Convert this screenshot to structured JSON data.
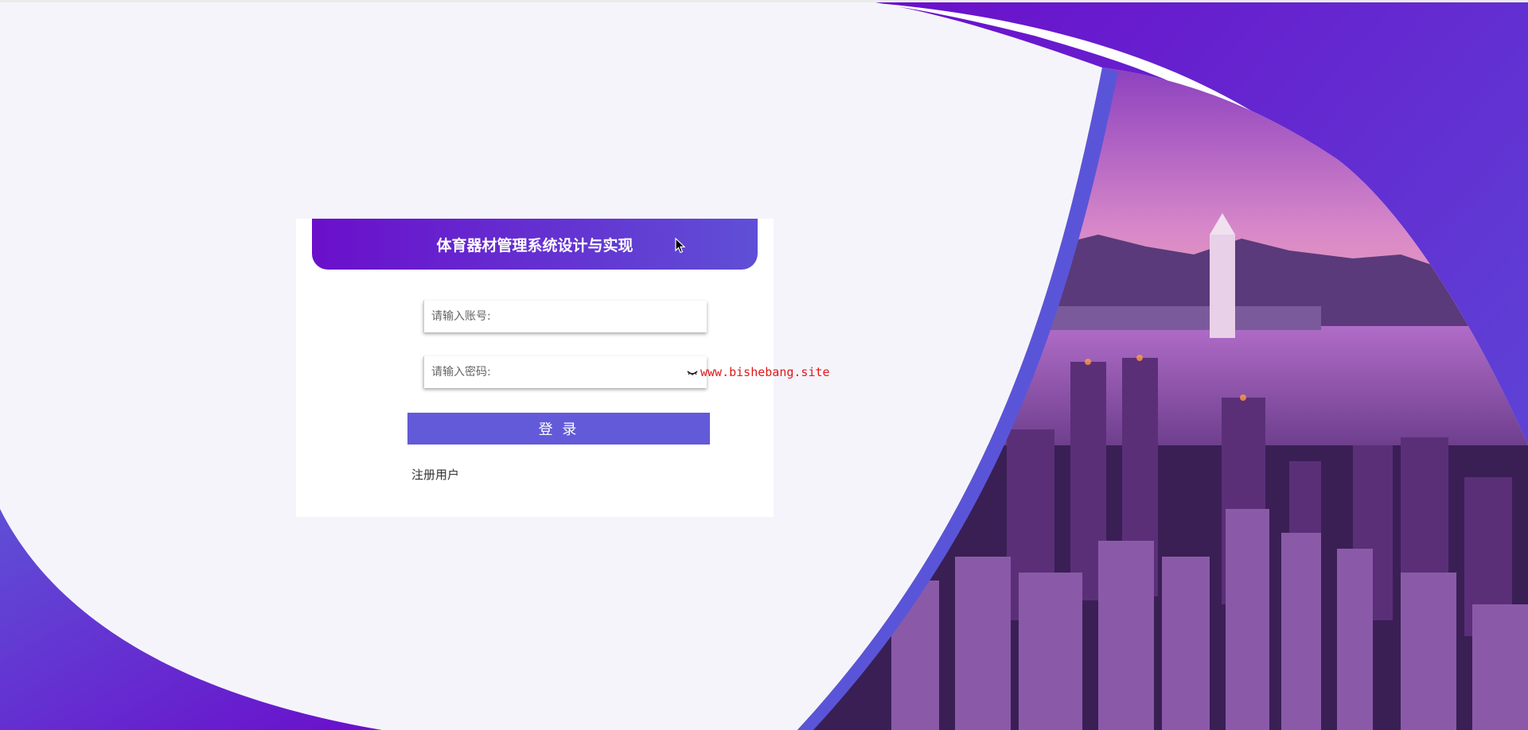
{
  "header": {
    "title": "体育器材管理系统设计与实现"
  },
  "form": {
    "account_label": "账号:",
    "account_placeholder": "请输入账号:",
    "account_value": "",
    "password_label": "密码:",
    "password_placeholder": "请输入密码:",
    "password_value": "",
    "login_label": "登 录",
    "register_label": "注册用户"
  },
  "watermark": {
    "text": "www.bishebang.site"
  },
  "icons": {
    "cursor": "cursor-arrow-icon",
    "password_toggle": "eye-closed-icon"
  },
  "colors": {
    "accent": "#625ad8",
    "banner_start": "#6a0fcb",
    "banner_end": "#5f4fd6",
    "watermark": "#e01818",
    "background": "#f5f4fb"
  }
}
